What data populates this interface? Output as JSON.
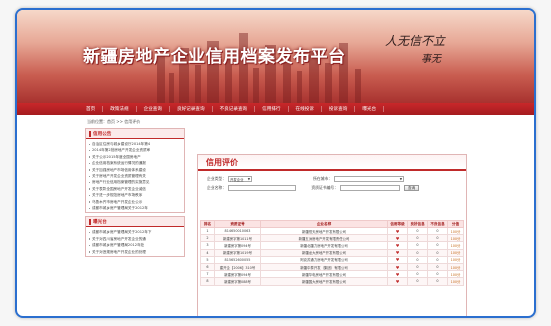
{
  "header": {
    "title": "新疆房地产企业信用档案发布平台",
    "slogan_line1": "人无信不立",
    "slogan_line2": "事无"
  },
  "nav": {
    "items": [
      "首页",
      "政策法规",
      "企业查询",
      "良好记录查询",
      "不良记录查询",
      "信用排行",
      "在线投诉",
      "投诉查询",
      "曝光台"
    ]
  },
  "breadcrumb": "当前位置：首页 >> 信用评价",
  "sidebar": {
    "notice": {
      "title": "信用公告",
      "items": [
        "自治区住房与城乡建设厅2014年第4",
        "2014年第2批房地产开发企业资质审",
        "关于公示2015年度全国房地产",
        "企业信用档案系统运行情况的通报",
        "关于加强房地产市场信用体系建设",
        "关于房地产开发企业资质管理有关",
        "房地产行业信用档案管理的实施意见",
        "关于表彰全国房地产开发企业诚信",
        "关于进一步规范房地产市场秩序",
        "乌鲁木齐市房地产开发企业公示",
        "成都市城乡房产管理局关于2012年"
      ]
    },
    "exposure": {
      "title": "曝光台",
      "items": [
        "成都市城乡房产管理局关于2012年下",
        "关于对四川省房地产开发企业的通",
        "成都市城乡房产管理局2012年处",
        "关于对违规房地产开发企业的处理"
      ]
    }
  },
  "main": {
    "title": "信用评价",
    "filters": {
      "type_label": "企业类型：",
      "type_value": "开发企业",
      "city_label": "所在城市：",
      "city_value": "",
      "name_label": "企业名称：",
      "name_value": "",
      "cert_label": "资质证书编号：",
      "cert_value": "",
      "search_button": "查询"
    },
    "table": {
      "headers": [
        "排名",
        "资质证号",
        "企业名称",
        "信用等级",
        "良好信息",
        "不良信息",
        "分值"
      ],
      "rows": [
        [
          "1",
          "814650010063",
          "新疆恒天房地产开发有限公司",
          "♥",
          "0",
          "0",
          "100分"
        ],
        [
          "2",
          "新建房字第1011号",
          "新疆五洲房地产开发有限责任公司",
          "♥",
          "0",
          "0",
          "100分"
        ],
        [
          "3",
          "新建房字第094号",
          "新疆北疆力房地产开发有限公司",
          "♥",
          "0",
          "0",
          "100分"
        ],
        [
          "4",
          "新建房字第1019号",
          "新疆龙大房地产开发有限公司",
          "♥",
          "0",
          "0",
          "100分"
        ],
        [
          "5",
          "815652600055",
          "阿克苏通力房地产开发有限公司",
          "♥",
          "0",
          "0",
          "100分"
        ],
        [
          "6",
          "建开企【2006】310号",
          "新疆中泰开发（集团）有限公司",
          "♥",
          "0",
          "0",
          "100分"
        ],
        [
          "7",
          "新建房字第094号",
          "新疆华电房地产开发有限公司",
          "♥",
          "0",
          "0",
          "100分"
        ],
        [
          "8",
          "新建房字第088号",
          "新疆国大房地产开发有限公司",
          "♥",
          "0",
          "0",
          "100分"
        ]
      ]
    }
  }
}
